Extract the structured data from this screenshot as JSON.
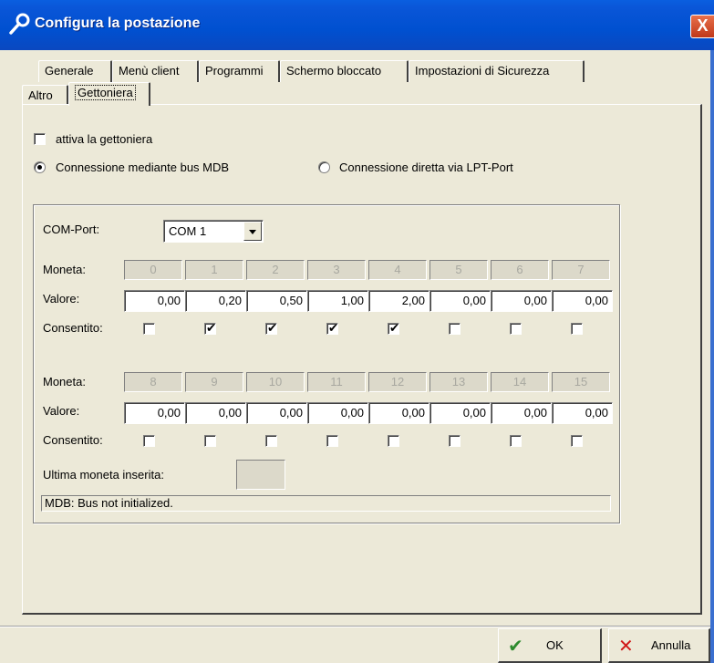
{
  "window": {
    "title": "Configura la postazione",
    "close_glyph": "X",
    "title_icon": "wrench-icon"
  },
  "tabs": {
    "row1": [
      "Generale",
      "Menù client",
      "Programmi",
      "Schermo bloccato",
      "Impostazioni di Sicurezza"
    ],
    "row2": [
      "Altro",
      "Gettoniera"
    ],
    "active": "Gettoniera"
  },
  "options": {
    "enable_label": "attiva la gettoniera",
    "enable_checked": false,
    "radio_mdb_label": "Connessione mediante bus MDB",
    "radio_mdb_selected": true,
    "radio_lpt_label": "Connessione diretta via LPT-Port",
    "radio_lpt_selected": false
  },
  "settings": {
    "com_label": "COM-Port:",
    "com_value": "COM 1",
    "moneta_label": "Moneta:",
    "valore_label": "Valore:",
    "consentito_label": "Consentito:",
    "last_coin_label": "Ultima moneta inserita:",
    "last_coin_value": "",
    "status": "MDB: Bus not initialized."
  },
  "coins_row1": {
    "ids": [
      "0",
      "1",
      "2",
      "3",
      "4",
      "5",
      "6",
      "7"
    ],
    "values": [
      "0,00",
      "0,20",
      "0,50",
      "1,00",
      "2,00",
      "0,00",
      "0,00",
      "0,00"
    ],
    "allowed": [
      false,
      true,
      true,
      true,
      true,
      false,
      false,
      false
    ]
  },
  "coins_row2": {
    "ids": [
      "8",
      "9",
      "10",
      "11",
      "12",
      "13",
      "14",
      "15"
    ],
    "values": [
      "0,00",
      "0,00",
      "0,00",
      "0,00",
      "0,00",
      "0,00",
      "0,00",
      "0,00"
    ],
    "allowed": [
      false,
      false,
      false,
      false,
      false,
      false,
      false,
      false
    ]
  },
  "buttons": {
    "ok_label": "OK",
    "ok_icon": "check-icon",
    "cancel_label": "Annulla",
    "cancel_icon": "x-icon"
  },
  "colors": {
    "titlebar": "#0050D0",
    "ok_check": "#2E8B2E",
    "cancel_x": "#D01818"
  }
}
